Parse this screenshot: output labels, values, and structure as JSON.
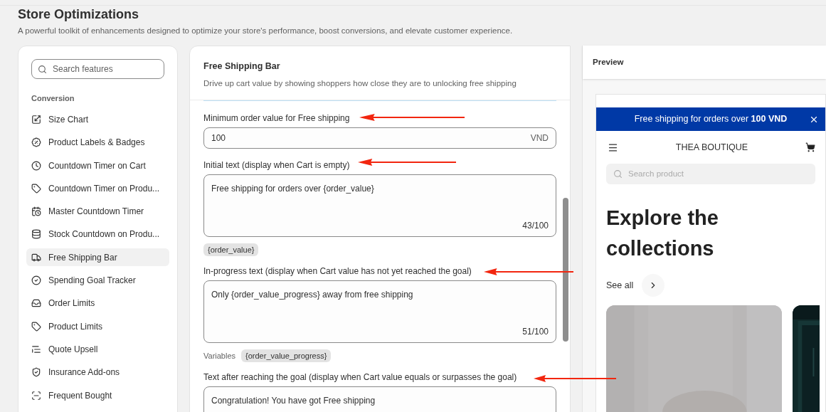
{
  "page": {
    "title": "Store Optimizations",
    "subtitle": "A powerful toolkit of enhancements designed to optimize your store's performance, boost conversions, and elevate customer experience."
  },
  "sidebar": {
    "search": {
      "placeholder": "Search features"
    },
    "section": "Conversion",
    "items": [
      {
        "label": "Size Chart",
        "selected": false
      },
      {
        "label": "Product Labels & Badges",
        "selected": false
      },
      {
        "label": "Countdown Timer on Cart",
        "selected": false
      },
      {
        "label": "Countdown Timer on Produ...",
        "selected": false
      },
      {
        "label": "Master Countdown Timer",
        "selected": false
      },
      {
        "label": "Stock Countdown on Produ...",
        "selected": false
      },
      {
        "label": "Free Shipping Bar",
        "selected": true
      },
      {
        "label": "Spending Goal Tracker",
        "selected": false
      },
      {
        "label": "Order Limits",
        "selected": false
      },
      {
        "label": "Product Limits",
        "selected": false
      },
      {
        "label": "Quote Upsell",
        "selected": false
      },
      {
        "label": "Insurance Add-ons",
        "selected": false
      },
      {
        "label": "Frequent Bought",
        "selected": false
      }
    ]
  },
  "editor": {
    "title": "Free Shipping Bar",
    "description": "Drive up cart value by showing shoppers how close they are to unlocking free shipping",
    "fields": [
      {
        "kind": "input",
        "label": "Minimum order value for Free shipping",
        "value": "100",
        "suffix": "VND"
      },
      {
        "kind": "textarea",
        "label": "Initial text (display when Cart is empty)",
        "value": "Free shipping for orders over {order_value}",
        "counter": "43/100",
        "variables": [
          "{order_value}"
        ]
      },
      {
        "kind": "textarea",
        "label": "In-progress text (display when Cart value has not yet reached the goal)",
        "value": "Only {order_value_progress} away from free shipping",
        "counter": "51/100",
        "variables_label": "Variables",
        "variables": [
          "{order_value_progress}"
        ]
      },
      {
        "kind": "textarea",
        "label": "Text after reaching the goal (display when Cart value equals or surpasses the goal)",
        "value": "Congratulation! You have got Free shipping"
      }
    ]
  },
  "preview": {
    "title": "Preview",
    "banner": "Free shipping for orders over **100 VND**",
    "store_name": "THEA BOUTIQUE",
    "search_placeholder": "Search product",
    "headline": "Explore the collections",
    "see_all": "See all"
  }
}
